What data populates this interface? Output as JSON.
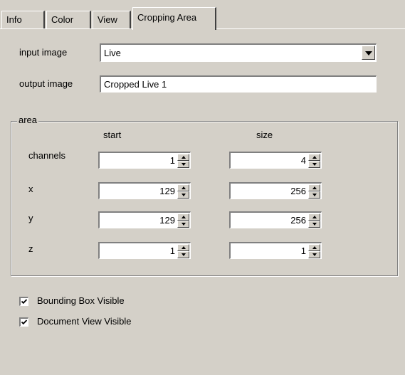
{
  "tabs": [
    {
      "label": "Info",
      "active": false
    },
    {
      "label": "Color",
      "active": false
    },
    {
      "label": "View",
      "active": false
    },
    {
      "label": "Cropping Area",
      "active": true
    }
  ],
  "input_image": {
    "label": "input  image",
    "value": "Live"
  },
  "output_image": {
    "label": "output image",
    "value": "Cropped Live 1"
  },
  "area": {
    "title": "area",
    "col_start": "start",
    "col_size": "size",
    "rows": [
      {
        "label": "channels",
        "start": "1",
        "size": "4"
      },
      {
        "label": "x",
        "start": "129",
        "size": "256"
      },
      {
        "label": "y",
        "start": "129",
        "size": "256"
      },
      {
        "label": "z",
        "start": "1",
        "size": "1"
      }
    ]
  },
  "checkboxes": [
    {
      "label": "Bounding Box Visible",
      "checked": true
    },
    {
      "label": "Document View Visible",
      "checked": true
    }
  ],
  "icons": {
    "combo_arrow": "chevron-down-icon",
    "spin_up": "arrow-up-icon",
    "spin_down": "arrow-down-icon",
    "check": "check-icon"
  }
}
